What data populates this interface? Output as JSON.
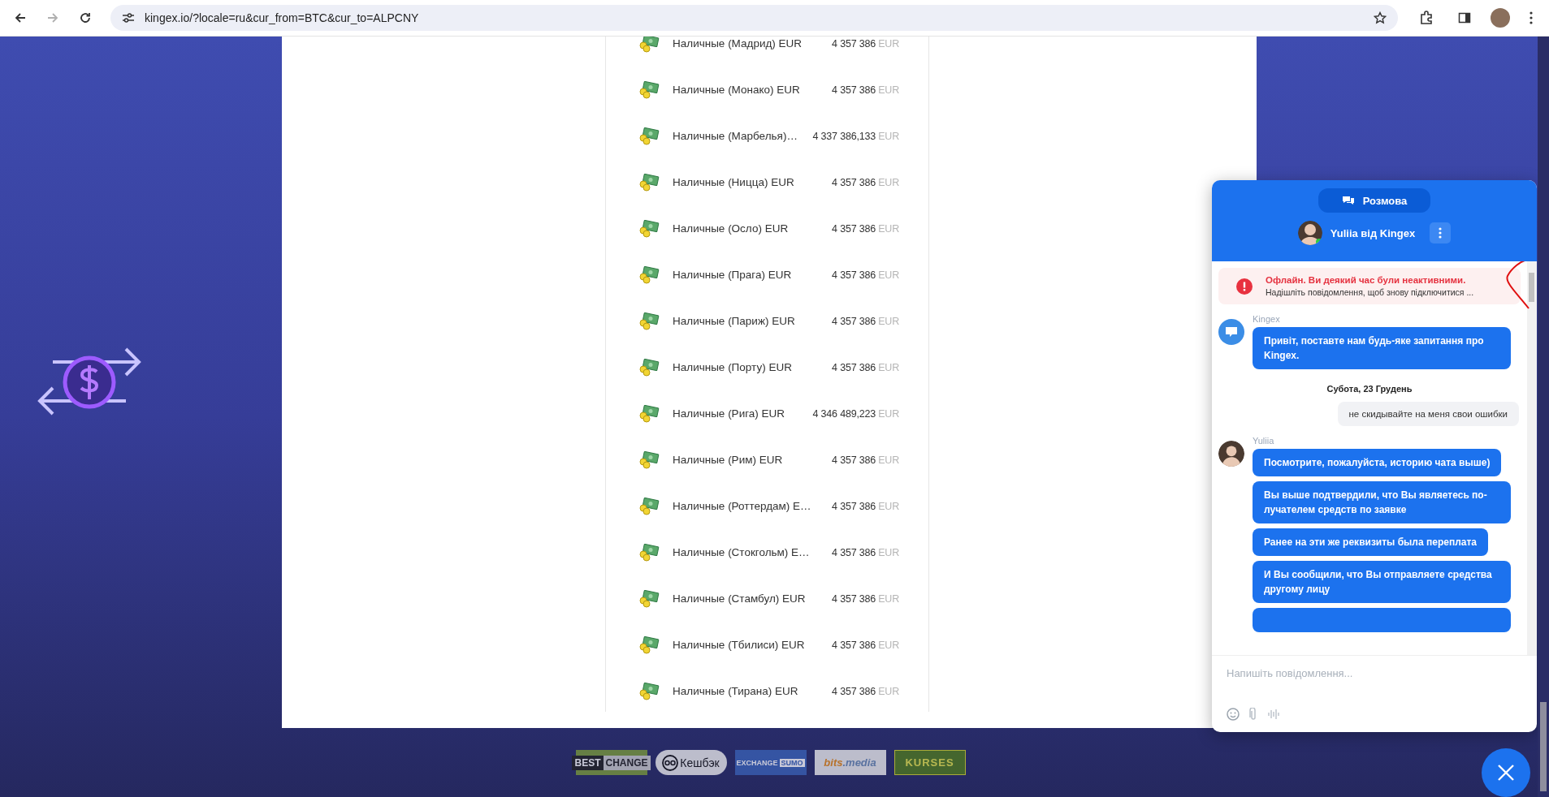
{
  "browser": {
    "url": "kingex.io/?locale=ru&cur_from=BTC&cur_to=ALPCNY",
    "back_disabled": false,
    "forward_disabled": true
  },
  "currency_list": [
    {
      "name": "Наличные (Мадрид) EUR",
      "amount": "4 357 386",
      "currency": "EUR"
    },
    {
      "name": "Наличные (Монако) EUR",
      "amount": "4 357 386",
      "currency": "EUR"
    },
    {
      "name": "Наличные (Марбелья)…",
      "amount": "4 337 386,133",
      "currency": "EUR"
    },
    {
      "name": "Наличные (Ницца) EUR",
      "amount": "4 357 386",
      "currency": "EUR"
    },
    {
      "name": "Наличные (Осло) EUR",
      "amount": "4 357 386",
      "currency": "EUR"
    },
    {
      "name": "Наличные (Прага) EUR",
      "amount": "4 357 386",
      "currency": "EUR"
    },
    {
      "name": "Наличные (Париж) EUR",
      "amount": "4 357 386",
      "currency": "EUR"
    },
    {
      "name": "Наличные (Порту) EUR",
      "amount": "4 357 386",
      "currency": "EUR"
    },
    {
      "name": "Наличные (Рига) EUR",
      "amount": "4 346 489,223",
      "currency": "EUR"
    },
    {
      "name": "Наличные (Рим) EUR",
      "amount": "4 357 386",
      "currency": "EUR"
    },
    {
      "name": "Наличные (Роттердам) E…",
      "amount": "4 357 386",
      "currency": "EUR"
    },
    {
      "name": "Наличные (Стокгольм) E…",
      "amount": "4 357 386",
      "currency": "EUR"
    },
    {
      "name": "Наличные (Стамбул) EUR",
      "amount": "4 357 386",
      "currency": "EUR"
    },
    {
      "name": "Наличные (Тбилиси) EUR",
      "amount": "4 357 386",
      "currency": "EUR"
    },
    {
      "name": "Наличные (Тирана) EUR",
      "amount": "4 357 386",
      "currency": "EUR"
    }
  ],
  "partners": [
    {
      "kind": "bestchange",
      "parts": [
        "BEST",
        "CHANGE"
      ]
    },
    {
      "kind": "cashback",
      "parts": [
        "Кешбэк"
      ]
    },
    {
      "kind": "sumo",
      "parts": [
        "EXCHANGE",
        "SUMO"
      ]
    },
    {
      "kind": "bits",
      "parts": [
        "bits",
        ".media"
      ]
    },
    {
      "kind": "kurses",
      "parts": [
        "KURSES"
      ]
    }
  ],
  "chat": {
    "tab": "Розмова",
    "agent": "Yuliia від Kingex",
    "agent_online": true,
    "notice": {
      "title": "Офлайн. Ви деякий час були неактивними.",
      "text": "Надішліть повідомлення, щоб знову підключитися ..."
    },
    "groups": [
      {
        "kind": "bot",
        "sender": "Kingex",
        "messages": [
          "Привіт, поставте нам будь-яке запитання про Kingex."
        ]
      },
      {
        "kind": "date",
        "text": "Субота, 23 Грудень"
      },
      {
        "kind": "visitor",
        "messages": [
          "не скидывайте на меня свои ошибки"
        ]
      },
      {
        "kind": "agent",
        "sender": "Yuliia",
        "messages": [
          "Посмотрите, пожалуйста, историю чата выше)",
          "Вы выше подтвердили, что Вы являетесь по-лучателем средств по заявке",
          "Ранее на эти же реквизиты была переплата",
          "И Вы сообщили, что Вы отправляете средства другому лицу"
        ],
        "more": true
      }
    ],
    "input_placeholder": "Напишіть повідомлення..."
  }
}
